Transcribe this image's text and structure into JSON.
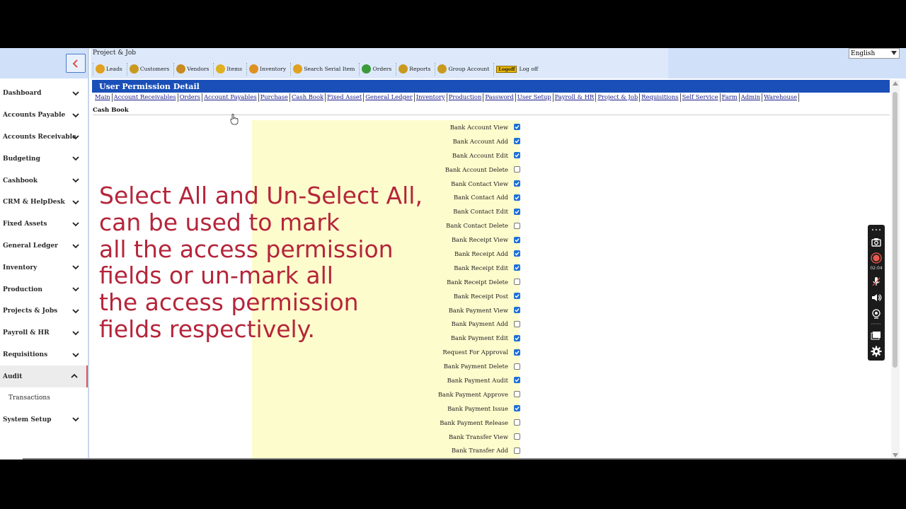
{
  "header": {
    "title": "Project & Job",
    "language": "English",
    "toolbar": [
      {
        "label": "Leads",
        "icon": "leads-icon",
        "color": "#e0a020"
      },
      {
        "label": "Customers",
        "icon": "customers-icon",
        "color": "#c99a20"
      },
      {
        "label": "Vendors",
        "icon": "vendors-icon",
        "color": "#c98a20"
      },
      {
        "label": "Items",
        "icon": "items-icon",
        "color": "#e0b020"
      },
      {
        "label": "Inventory",
        "icon": "inventory-icon",
        "color": "#e09020"
      },
      {
        "label": "Search Serial Item",
        "icon": "search-serial-icon",
        "color": "#e0a020"
      },
      {
        "label": "Orders",
        "icon": "orders-icon",
        "color": "#3a9a3a"
      },
      {
        "label": "Reports",
        "icon": "reports-icon",
        "color": "#c99a20"
      },
      {
        "label": "Group Account",
        "icon": "group-account-icon",
        "color": "#c99a20"
      }
    ],
    "logoff_badge": "Logoff",
    "logoff_label": "Log off"
  },
  "sidebar": {
    "items": [
      {
        "label": "Dashboard",
        "expanded": false
      },
      {
        "label": "Accounts Payable",
        "expanded": false
      },
      {
        "label": "Accounts Receivable",
        "expanded": false
      },
      {
        "label": "Budgeting",
        "expanded": false
      },
      {
        "label": "Cashbook",
        "expanded": false
      },
      {
        "label": "CRM & HelpDesk",
        "expanded": false
      },
      {
        "label": "Fixed Assets",
        "expanded": false
      },
      {
        "label": "General Ledger",
        "expanded": false
      },
      {
        "label": "Inventory",
        "expanded": false
      },
      {
        "label": "Production",
        "expanded": false
      },
      {
        "label": "Projects & Jobs",
        "expanded": false
      },
      {
        "label": "Payroll & HR",
        "expanded": false
      },
      {
        "label": "Requisitions",
        "expanded": false
      },
      {
        "label": "Audit",
        "expanded": true,
        "sub": [
          "Transactions"
        ]
      },
      {
        "label": "System Setup",
        "expanded": false
      }
    ]
  },
  "content": {
    "title": "User Permission Detail",
    "modules": [
      "Main",
      "Account Receivables",
      "Orders",
      "Account Payables",
      "Purchase",
      "Cash Book",
      "Fixed Asset",
      "General Ledger",
      "Inventory",
      "Production",
      "Password",
      "User Setup",
      "Payroll & HR",
      "Project & Job",
      "Requisitions",
      "Self Service",
      "Farm",
      "Admin",
      "Warehouse"
    ],
    "section": "Cash Book",
    "permissions": [
      {
        "label": "Bank Account View",
        "checked": true
      },
      {
        "label": "Bank Account Add",
        "checked": true
      },
      {
        "label": "Bank Account Edit",
        "checked": true
      },
      {
        "label": "Bank Account Delete",
        "checked": false
      },
      {
        "label": "Bank Contact View",
        "checked": true
      },
      {
        "label": "Bank Contact Add",
        "checked": true
      },
      {
        "label": "Bank Contact Edit",
        "checked": true
      },
      {
        "label": "Bank Contact Delete",
        "checked": false
      },
      {
        "label": "Bank Receipt View",
        "checked": true
      },
      {
        "label": "Bank Receipt Add",
        "checked": true
      },
      {
        "label": "Bank Receipt Edit",
        "checked": true
      },
      {
        "label": "Bank Receipt Delete",
        "checked": false
      },
      {
        "label": "Bank Receipt Post",
        "checked": true
      },
      {
        "label": "Bank Payment View",
        "checked": true
      },
      {
        "label": "Bank Payment Add",
        "checked": false
      },
      {
        "label": "Bank Payment Edit",
        "checked": true
      },
      {
        "label": "Request For Approval",
        "checked": true
      },
      {
        "label": "Bank Payment Delete",
        "checked": false
      },
      {
        "label": "Bank Payment Audit",
        "checked": true
      },
      {
        "label": "Bank Payment Approve",
        "checked": false
      },
      {
        "label": "Bank Payment Issue",
        "checked": true
      },
      {
        "label": "Bank Payment Release",
        "checked": false
      },
      {
        "label": "Bank Transfer View",
        "checked": false
      },
      {
        "label": "Bank Transfer Add",
        "checked": false
      }
    ]
  },
  "overlay": {
    "lines": [
      "Select All and Un-Select All,",
      "can be used to mark",
      "all the access permission",
      "fields or un-mark all",
      "the access permission",
      "fields respectively."
    ]
  },
  "recorder": {
    "time": "02:04"
  },
  "colors": {
    "accent_blue": "#1a4fb8",
    "checkbox_blue": "#1e6fd9",
    "overlay_red": "#b5253a",
    "highlight_yellow": "#fdfccd"
  }
}
